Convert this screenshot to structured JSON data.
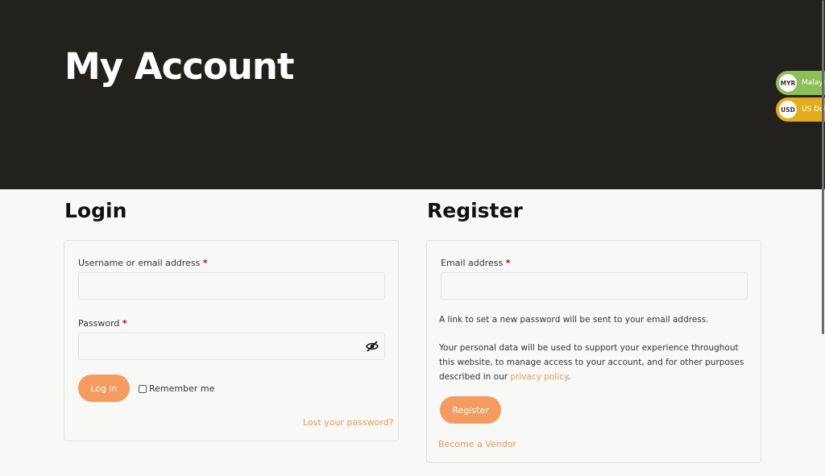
{
  "page": {
    "title": "My Account"
  },
  "currency_switcher": [
    {
      "code": "MYR",
      "name": "Malaysian Ringgit",
      "color": "#8bbf57"
    },
    {
      "code": "USD",
      "name": "US Dollar",
      "color": "#e2ad1d"
    }
  ],
  "login": {
    "heading": "Login",
    "username_label": "Username or email address",
    "username_value": "",
    "password_label": "Password",
    "password_value": "",
    "required_mark": "*",
    "login_button": "Log in",
    "remember_label": "Remember me",
    "lost_password": "Lost your password?"
  },
  "register": {
    "heading": "Register",
    "email_label": "Email address",
    "email_value": "",
    "required_mark": "*",
    "info_text": "A link to set a new password will be sent to your email address.",
    "privacy_text_before": "Your personal data will be used to support your experience throughout this website, to manage access to your account, and for other purposes described in our ",
    "privacy_link": "privacy policy",
    "privacy_text_after": ".",
    "register_button": "Register",
    "vendor_link": "Become a Vendor"
  },
  "colors": {
    "hero_bg": "#23211e",
    "accent": "#f59b5f",
    "link": "#e89a55"
  }
}
